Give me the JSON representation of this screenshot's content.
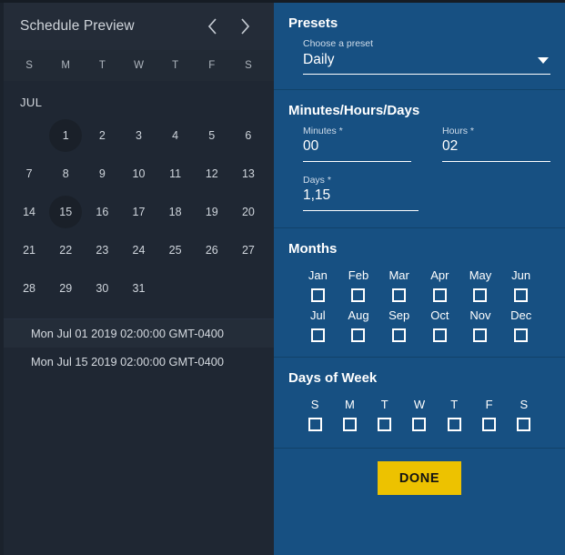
{
  "preview": {
    "title": "Schedule Preview",
    "prev_icon": "chevron-left-icon",
    "next_icon": "chevron-right-icon",
    "weekday_headers": [
      "S",
      "M",
      "T",
      "W",
      "T",
      "F",
      "S"
    ],
    "month_label": "JUL",
    "leading_blanks": 1,
    "days": [
      1,
      2,
      3,
      4,
      5,
      6,
      7,
      8,
      9,
      10,
      11,
      12,
      13,
      14,
      15,
      16,
      17,
      18,
      19,
      20,
      21,
      22,
      23,
      24,
      25,
      26,
      27,
      28,
      29,
      30,
      31
    ],
    "selected_days": [
      1,
      15
    ],
    "date_list": [
      {
        "text": "Mon Jul 01 2019 02:00:00 GMT-0400",
        "highlighted": true
      },
      {
        "text": "Mon Jul 15 2019 02:00:00 GMT-0400",
        "highlighted": false
      }
    ]
  },
  "settings": {
    "presets": {
      "title": "Presets",
      "label": "Choose a preset",
      "value": "Daily",
      "caret_icon": "chevron-down-icon"
    },
    "mhd": {
      "title": "Minutes/Hours/Days",
      "minutes": {
        "label": "Minutes *",
        "value": "00"
      },
      "hours": {
        "label": "Hours *",
        "value": "02"
      },
      "days": {
        "label": "Days *",
        "value": "1,15"
      }
    },
    "months": {
      "title": "Months",
      "items": [
        {
          "label": "Jan",
          "checked": false
        },
        {
          "label": "Feb",
          "checked": false
        },
        {
          "label": "Mar",
          "checked": false
        },
        {
          "label": "Apr",
          "checked": false
        },
        {
          "label": "May",
          "checked": false
        },
        {
          "label": "Jun",
          "checked": false
        },
        {
          "label": "Jul",
          "checked": false
        },
        {
          "label": "Aug",
          "checked": false
        },
        {
          "label": "Sep",
          "checked": false
        },
        {
          "label": "Oct",
          "checked": false
        },
        {
          "label": "Nov",
          "checked": false
        },
        {
          "label": "Dec",
          "checked": false
        }
      ]
    },
    "days_of_week": {
      "title": "Days of Week",
      "items": [
        {
          "label": "S",
          "checked": false
        },
        {
          "label": "M",
          "checked": false
        },
        {
          "label": "T",
          "checked": false
        },
        {
          "label": "W",
          "checked": false
        },
        {
          "label": "T",
          "checked": false
        },
        {
          "label": "F",
          "checked": false
        },
        {
          "label": "S",
          "checked": false
        }
      ]
    },
    "done_label": "DONE"
  },
  "colors": {
    "panel_blue": "#175082",
    "sidebar_dark": "#1f2733",
    "sidebar_header": "#242c38",
    "accent_yellow": "#edc200",
    "selected_day": "#1a2029"
  }
}
